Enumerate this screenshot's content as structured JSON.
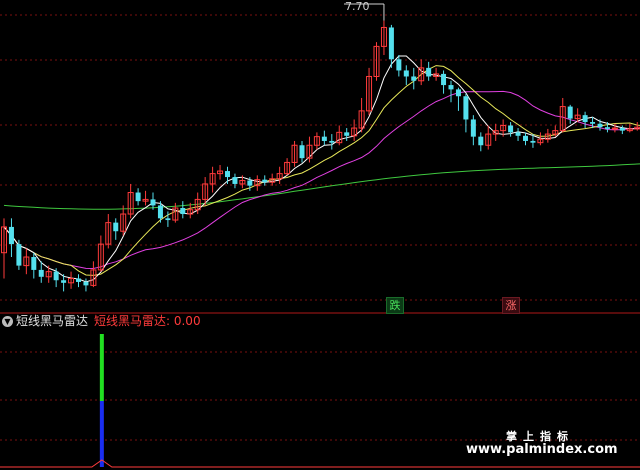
{
  "colors": {
    "background": "#000000",
    "up_candle": "#ff3b3b",
    "down_candle": "#54e0ee",
    "ma_short": "#ffffff",
    "ma_mid": "#e8e85a",
    "ma_long": "#e040e0",
    "ma_longest": "#3fc83f",
    "grid": "#7a1010",
    "indicator_green": "#21e021",
    "indicator_blue": "#1a2ef0",
    "indicator_curve": "#ff3b3b"
  },
  "upper_panel": {
    "high_label": "7.70",
    "badge_down": "跌",
    "badge_up": "涨"
  },
  "lower_panel": {
    "collapse_icon": "chevron-down-icon",
    "title": "短线黑马雷达",
    "legend": "短线黑马雷达: 0.00"
  },
  "watermark": {
    "cn": "掌上指标",
    "url": "www.palmindex.com"
  },
  "chart_data": {
    "type": "candlestick",
    "candles": [
      [
        5.0,
        5.3,
        4.7,
        5.4
      ],
      [
        5.3,
        5.1,
        4.95,
        5.4
      ],
      [
        5.1,
        4.85,
        4.8,
        5.15
      ],
      [
        4.85,
        4.95,
        4.75,
        5.05
      ],
      [
        4.95,
        4.8,
        4.7,
        5.0
      ],
      [
        4.8,
        4.72,
        4.65,
        4.9
      ],
      [
        4.72,
        4.78,
        4.65,
        4.85
      ],
      [
        4.78,
        4.68,
        4.6,
        4.82
      ],
      [
        4.68,
        4.65,
        4.55,
        4.75
      ],
      [
        4.65,
        4.7,
        4.58,
        4.78
      ],
      [
        4.7,
        4.66,
        4.6,
        4.75
      ],
      [
        4.66,
        4.62,
        4.55,
        4.7
      ],
      [
        4.62,
        4.8,
        4.6,
        4.9
      ],
      [
        4.8,
        5.1,
        4.78,
        5.2
      ],
      [
        5.1,
        5.35,
        5.05,
        5.45
      ],
      [
        5.35,
        5.25,
        5.15,
        5.4
      ],
      [
        5.25,
        5.45,
        5.2,
        5.55
      ],
      [
        5.45,
        5.7,
        5.4,
        5.8
      ],
      [
        5.7,
        5.6,
        5.55,
        5.75
      ],
      [
        5.6,
        5.62,
        5.55,
        5.72
      ],
      [
        5.62,
        5.55,
        5.5,
        5.7
      ],
      [
        5.55,
        5.4,
        5.35,
        5.6
      ],
      [
        5.4,
        5.38,
        5.3,
        5.48
      ],
      [
        5.38,
        5.52,
        5.35,
        5.58
      ],
      [
        5.52,
        5.45,
        5.4,
        5.6
      ],
      [
        5.45,
        5.5,
        5.4,
        5.58
      ],
      [
        5.5,
        5.62,
        5.45,
        5.7
      ],
      [
        5.62,
        5.8,
        5.55,
        5.88
      ],
      [
        5.8,
        5.92,
        5.7,
        6.0
      ],
      [
        5.92,
        5.95,
        5.85,
        6.02
      ],
      [
        5.95,
        5.88,
        5.8,
        6.0
      ],
      [
        5.88,
        5.8,
        5.75,
        5.92
      ],
      [
        5.8,
        5.84,
        5.75,
        5.9
      ],
      [
        5.84,
        5.78,
        5.72,
        5.88
      ],
      [
        5.78,
        5.85,
        5.72,
        5.9
      ],
      [
        5.85,
        5.82,
        5.78,
        5.9
      ],
      [
        5.82,
        5.86,
        5.78,
        5.92
      ],
      [
        5.86,
        5.92,
        5.8,
        6.0
      ],
      [
        5.92,
        6.05,
        5.9,
        6.1
      ],
      [
        6.05,
        6.25,
        6.0,
        6.3
      ],
      [
        6.25,
        6.1,
        6.05,
        6.3
      ],
      [
        6.1,
        6.25,
        6.05,
        6.35
      ],
      [
        6.25,
        6.35,
        6.2,
        6.4
      ],
      [
        6.35,
        6.3,
        6.25,
        6.42
      ],
      [
        6.3,
        6.28,
        6.2,
        6.38
      ],
      [
        6.28,
        6.4,
        6.25,
        6.48
      ],
      [
        6.4,
        6.36,
        6.3,
        6.45
      ],
      [
        6.36,
        6.45,
        6.3,
        6.55
      ],
      [
        6.45,
        6.65,
        6.4,
        6.8
      ],
      [
        6.65,
        7.05,
        6.6,
        7.15
      ],
      [
        7.05,
        7.4,
        7.0,
        7.45
      ],
      [
        7.4,
        7.62,
        7.3,
        7.7
      ],
      [
        7.62,
        7.25,
        7.15,
        7.65
      ],
      [
        7.25,
        7.12,
        7.05,
        7.3
      ],
      [
        7.12,
        7.05,
        6.95,
        7.18
      ],
      [
        7.05,
        7.0,
        6.9,
        7.15
      ],
      [
        7.0,
        7.15,
        6.95,
        7.25
      ],
      [
        7.15,
        7.05,
        7.0,
        7.22
      ],
      [
        7.05,
        7.08,
        7.0,
        7.15
      ],
      [
        7.08,
        6.95,
        6.85,
        7.12
      ],
      [
        6.95,
        6.9,
        6.75,
        7.0
      ],
      [
        6.9,
        6.82,
        6.65,
        6.92
      ],
      [
        6.82,
        6.55,
        6.4,
        6.85
      ],
      [
        6.55,
        6.35,
        6.25,
        6.6
      ],
      [
        6.35,
        6.25,
        6.18,
        6.4
      ],
      [
        6.25,
        6.38,
        6.2,
        6.48
      ],
      [
        6.38,
        6.42,
        6.3,
        6.5
      ],
      [
        6.42,
        6.48,
        6.35,
        6.55
      ],
      [
        6.48,
        6.4,
        6.35,
        6.52
      ],
      [
        6.4,
        6.36,
        6.3,
        6.45
      ],
      [
        6.36,
        6.3,
        6.25,
        6.4
      ],
      [
        6.3,
        6.28,
        6.22,
        6.38
      ],
      [
        6.28,
        6.32,
        6.25,
        6.4
      ],
      [
        6.32,
        6.38,
        6.28,
        6.44
      ],
      [
        6.38,
        6.42,
        6.35,
        6.48
      ],
      [
        6.42,
        6.7,
        6.4,
        6.8
      ],
      [
        6.7,
        6.56,
        6.5,
        6.72
      ],
      [
        6.56,
        6.6,
        6.52,
        6.68
      ],
      [
        6.6,
        6.52,
        6.45,
        6.64
      ],
      [
        6.52,
        6.5,
        6.45,
        6.58
      ],
      [
        6.5,
        6.46,
        6.42,
        6.55
      ],
      [
        6.46,
        6.44,
        6.4,
        6.52
      ],
      [
        6.44,
        6.45,
        6.4,
        6.5
      ],
      [
        6.45,
        6.42,
        6.38,
        6.48
      ],
      [
        6.42,
        6.44,
        6.4,
        6.5
      ],
      [
        6.44,
        6.46,
        6.42,
        6.52
      ],
      [
        6.46,
        6.45,
        6.42,
        6.5
      ]
    ],
    "indicator": {
      "name": "短线黑马雷达",
      "spike_index": 13,
      "value": 0.0
    }
  }
}
